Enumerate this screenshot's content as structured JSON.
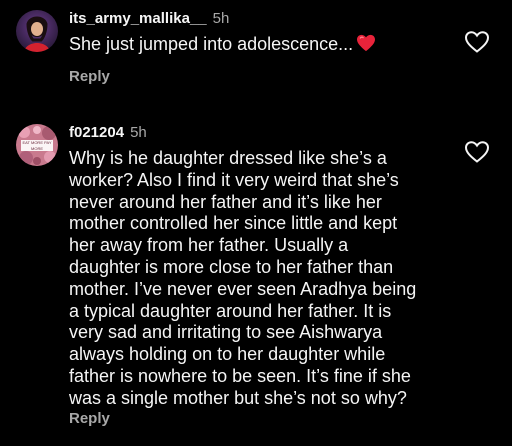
{
  "comments": [
    {
      "username": "its_army_mallika__",
      "time": "5h",
      "text_lines": [
        "She just jumped into adolescence..."
      ],
      "emoji": "red-heart",
      "reply_label": "Reply"
    },
    {
      "username": "f021204",
      "time": "5h",
      "avatar_caption": "EAT MORE PAY MORE",
      "text_lines": [
        "Why is he daughter dressed like she’s a",
        "worker? Also I find it very weird that she’s",
        "never around her father and it’s like her",
        "mother controlled her since little and kept",
        "her away from her father. Usually a",
        "daughter is more close to her father than",
        "mother. I’ve never ever seen Aradhya being",
        "a typical daughter around her father. It is",
        "very sad and irritating to see Aishwarya",
        "always holding on to her daughter while",
        "father is nowhere to be seen. It’s fine if she",
        "was a single mother but she’s not so why?"
      ],
      "reply_label": "Reply"
    }
  ],
  "colors": {
    "background": "#000000",
    "primary_text": "#f5f5f5",
    "secondary_text": "#a8a8a8",
    "heart_emoji": "#e8233a"
  },
  "icons": {
    "like": "heart-outline-icon"
  }
}
